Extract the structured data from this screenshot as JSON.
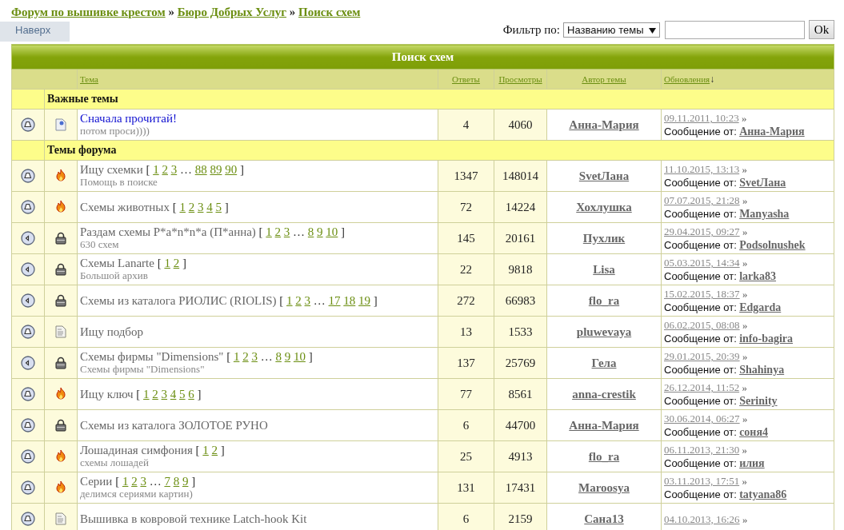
{
  "breadcrumb": [
    {
      "text": "Форум по вышивке крестом"
    },
    {
      "text": "»",
      "kind": "sep"
    },
    {
      "text": "Бюро Добрых Услуг"
    },
    {
      "text": "»",
      "kind": "sep"
    },
    {
      "text": "Поиск схем"
    }
  ],
  "top_tab": "Наверх",
  "filter": {
    "label": "Фильтр по:",
    "select": "Названию темы",
    "button": "Ok"
  },
  "table": {
    "title": "Поиск схем",
    "columns": [
      "Тема",
      "Ответы",
      "Просмотры",
      "Автор темы",
      "Обновления"
    ],
    "sort_mark": "↓",
    "sections": [
      {
        "title": "Важные темы",
        "rows": [
          {
            "unread": true,
            "kind": "sticky",
            "title": "Сначала прочитай!",
            "subtitle": "потом проси))))",
            "replies": "4",
            "views": "4060",
            "author": "Анна-Мария",
            "date": "09.11.2011, 10:23",
            "arrow": "»",
            "by_label": "Сообщение от:",
            "by": "Анна-Мария"
          }
        ]
      },
      {
        "title": "Темы форума",
        "rows": [
          {
            "unread": true,
            "kind": "hot",
            "title": "Ищу схемки",
            "pager": [
              "[",
              "1",
              "2",
              "3",
              "…",
              "88",
              "89",
              "90",
              "]"
            ],
            "subtitle": "Помощь в поиске",
            "replies": "1347",
            "views": "148014",
            "author": "SvetЛана",
            "date": "11.10.2015, 13:13",
            "arrow": "»",
            "by_label": "Сообщение от:",
            "by": "SvetЛана"
          },
          {
            "unread": true,
            "kind": "hot",
            "title": "Схемы животных",
            "pager": [
              "[",
              "1",
              "2",
              "3",
              "4",
              "5",
              "]"
            ],
            "replies": "72",
            "views": "14224",
            "author": "Хохлушка",
            "date": "07.07.2015, 21:28",
            "arrow": "»",
            "by_label": "Сообщение от:",
            "by": "Manyasha"
          },
          {
            "unread": false,
            "kind": "locked",
            "title": "Раздам схемы P*a*n*n*a (П*анна)",
            "pager": [
              "[",
              "1",
              "2",
              "3",
              "…",
              "8",
              "9",
              "10",
              "]"
            ],
            "subtitle": "630 схем",
            "replies": "145",
            "views": "20161",
            "author": "Пухлик",
            "date": "29.04.2015, 09:27",
            "arrow": "»",
            "by_label": "Сообщение от:",
            "by": "Podsolnushek"
          },
          {
            "unread": false,
            "kind": "locked",
            "title": "Схемы Lanarte",
            "pager": [
              "[",
              "1",
              "2",
              "]"
            ],
            "subtitle": "Большой архив",
            "replies": "22",
            "views": "9818",
            "author": "Lisa",
            "date": "05.03.2015, 14:34",
            "arrow": "»",
            "by_label": "Сообщение от:",
            "by": "larka83"
          },
          {
            "unread": false,
            "kind": "locked",
            "title": "Схемы из каталога РИОЛИС (RIOLIS)",
            "pager": [
              "[",
              "1",
              "2",
              "3",
              "…",
              "17",
              "18",
              "19",
              "]"
            ],
            "replies": "272",
            "views": "66983",
            "author": "flo_ra",
            "date": "15.02.2015, 18:37",
            "arrow": "»",
            "by_label": "Сообщение от:",
            "by": "Edgarda"
          },
          {
            "unread": true,
            "kind": "doc",
            "title": "Ищу подбор",
            "replies": "13",
            "views": "1533",
            "author": "pluwevaya",
            "date": "06.02.2015, 08:08",
            "arrow": "»",
            "by_label": "Сообщение от:",
            "by": "info-bagira"
          },
          {
            "unread": false,
            "kind": "locked",
            "title": "Схемы фирмы \"Dimensions\"",
            "pager": [
              "[",
              "1",
              "2",
              "3",
              "…",
              "8",
              "9",
              "10",
              "]"
            ],
            "subtitle": "Схемы фирмы \"Dimensions\"",
            "replies": "137",
            "views": "25769",
            "author": "Гела",
            "date": "29.01.2015, 20:39",
            "arrow": "»",
            "by_label": "Сообщение от:",
            "by": "Shahinya"
          },
          {
            "unread": true,
            "kind": "hot",
            "title": "Ищу ключ",
            "pager": [
              "[",
              "1",
              "2",
              "3",
              "4",
              "5",
              "6",
              "]"
            ],
            "replies": "77",
            "views": "8561",
            "author": "anna-crestik",
            "date": "26.12.2014, 11:52",
            "arrow": "»",
            "by_label": "Сообщение от:",
            "by": "Serinity"
          },
          {
            "unread": true,
            "kind": "locked",
            "title": "Схемы из каталога ЗОЛОТОЕ РУНО",
            "replies": "6",
            "views": "44700",
            "author": "Анна-Мария",
            "date": "30.06.2014, 06:27",
            "arrow": "»",
            "by_label": "Сообщение от:",
            "by": "соня4"
          },
          {
            "unread": true,
            "kind": "hot",
            "title": "Лошадиная симфония",
            "pager": [
              "[",
              "1",
              "2",
              "]"
            ],
            "subtitle": "схемы лошадей",
            "replies": "25",
            "views": "4913",
            "author": "flo_ra",
            "date": "06.11.2013, 21:30",
            "arrow": "»",
            "by_label": "Сообщение от:",
            "by": "илия"
          },
          {
            "unread": true,
            "kind": "hot",
            "title": "Серии",
            "pager": [
              "[",
              "1",
              "2",
              "3",
              "…",
              "7",
              "8",
              "9",
              "]"
            ],
            "subtitle": "делимся сериями картин)",
            "replies": "131",
            "views": "17431",
            "author": "Maroosya",
            "date": "03.11.2013, 17:51",
            "arrow": "»",
            "by_label": "Сообщение от:",
            "by": "tatyana86"
          },
          {
            "unread": true,
            "kind": "doc",
            "title": "Вышивка в ковровой технике Latch-hook Kit",
            "replies": "6",
            "views": "2159",
            "author": "Сана13",
            "date": "04.10.2013, 16:26",
            "arrow": "»"
          }
        ]
      }
    ]
  }
}
